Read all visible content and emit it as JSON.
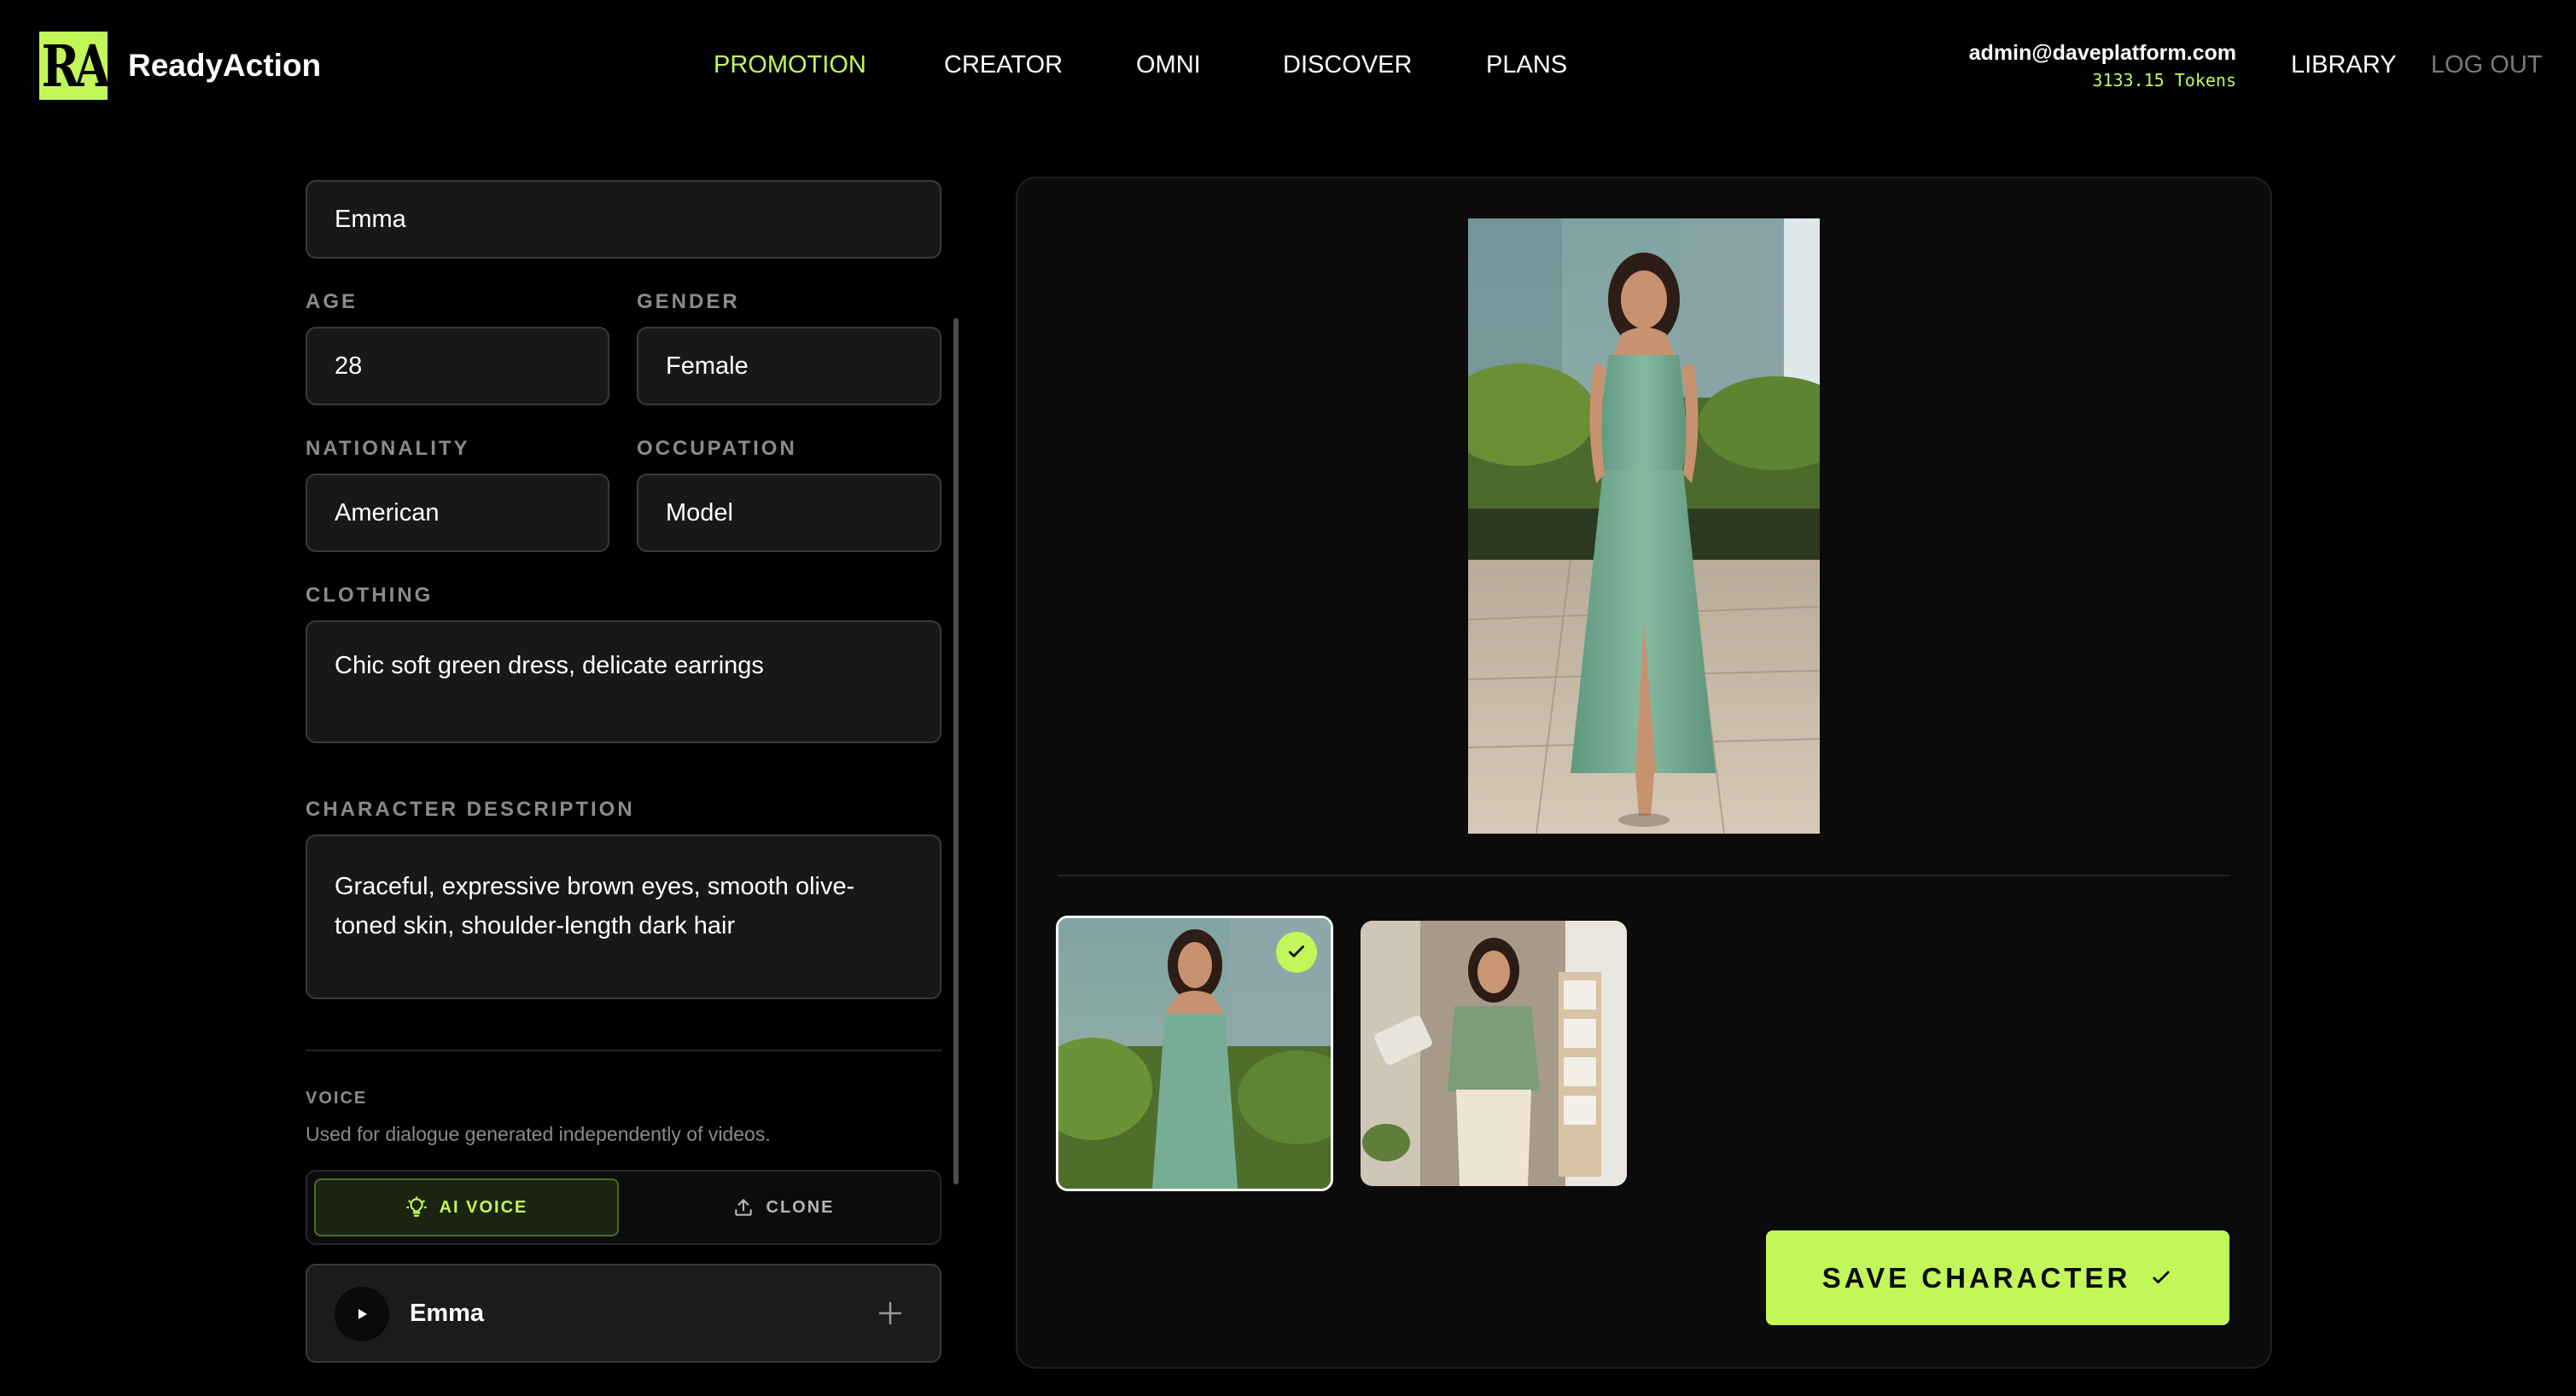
{
  "header": {
    "logo_text": "RA",
    "brand": "ReadyAction",
    "nav": [
      "PROMOTION",
      "CREATOR",
      "OMNI",
      "DISCOVER",
      "PLANS"
    ],
    "active_nav": "PROMOTION",
    "user_email": "admin@daveplatform.com",
    "tokens": "3133.15 Tokens",
    "library_label": "LIBRARY",
    "logout_label": "LOG OUT"
  },
  "form": {
    "name": "Emma",
    "age_label": "AGE",
    "age": "28",
    "gender_label": "GENDER",
    "gender": "Female",
    "nationality_label": "NATIONALITY",
    "nationality": "American",
    "occupation_label": "OCCUPATION",
    "occupation": "Model",
    "clothing_label": "CLOTHING",
    "clothing": "Chic soft green dress, delicate earrings",
    "description_label": "CHARACTER DESCRIPTION",
    "description": "Graceful, expressive brown eyes, smooth olive-\ntoned skin, shoulder-length dark hair"
  },
  "voice": {
    "title": "VOICE",
    "help": "Used for dialogue generated independently of videos.",
    "ai_voice_label": "AI VOICE",
    "clone_label": "CLONE",
    "selected_mode": "AI VOICE",
    "voice_name": "Emma"
  },
  "gallery": {
    "thumbnails": [
      {
        "description": "green wrap dress on rooftop",
        "selected": true
      },
      {
        "description": "green blouse with cream trousers in studio",
        "selected": false
      }
    ]
  },
  "actions": {
    "save_label": "SAVE CHARACTER"
  },
  "colors": {
    "accent": "#c2f75a",
    "background": "#000000",
    "panel": "#0b0b0b",
    "field": "#181818",
    "label": "#8b8b8b"
  }
}
